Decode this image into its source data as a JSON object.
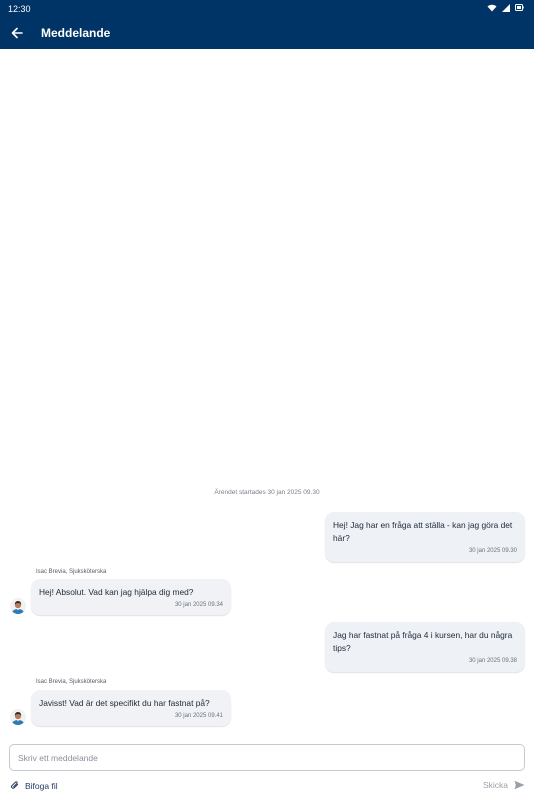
{
  "status_bar": {
    "time": "12:30",
    "icons": [
      "wifi-icon",
      "signal-icon",
      "battery-icon"
    ]
  },
  "header": {
    "back_icon": "arrow-left-icon",
    "title": "Meddelande",
    "background": "#003366"
  },
  "conversation": {
    "started_text": "Ärendet startades 30 jan 2025 09.30",
    "messages": [
      {
        "direction": "outgoing",
        "text": "Hej! Jag har en fråga att ställa - kan jag göra det här?",
        "time": "30 jan 2025 09.30"
      },
      {
        "direction": "incoming",
        "sender": "Isac Brevia, Sjuksköterska",
        "text": "Hej! Absolut. Vad kan jag hjälpa dig med?",
        "time": "30 jan 2025 09.34"
      },
      {
        "direction": "outgoing",
        "text": "Jag har fastnat på fråga 4 i kursen, har du några tips?",
        "time": "30 jan 2025 09.38"
      },
      {
        "direction": "incoming",
        "sender": "Isac Brevia, Sjuksköterska",
        "text": "Javisst! Vad är det specifikt du har fastnat på?",
        "time": "30 jan 2025 09.41"
      }
    ]
  },
  "composer": {
    "placeholder": "Skriv ett meddelande",
    "value": "",
    "attach_label": "Bifoga fil",
    "attach_icon": "paperclip-icon",
    "send_label": "Skicka",
    "send_icon": "send-icon"
  }
}
